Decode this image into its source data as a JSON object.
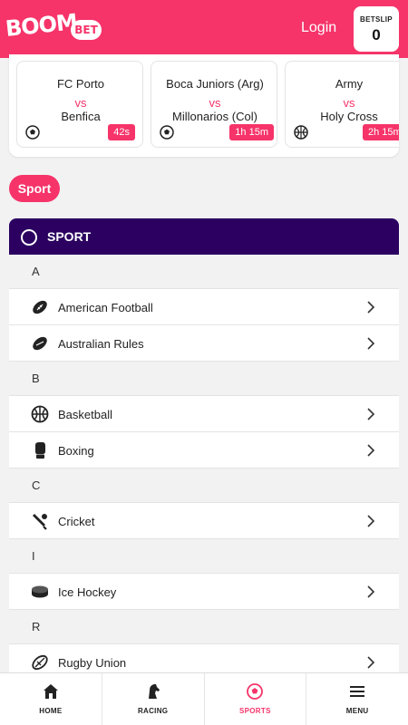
{
  "header": {
    "logo_text": "BOOM",
    "logo_badge": "BET",
    "login_label": "Login",
    "betslip_label": "BETSLIP",
    "betslip_count": "0"
  },
  "live_matches": [
    {
      "home": "FC Porto",
      "vs": "vs",
      "away": "Benfica",
      "time": "42s",
      "sport_icon": "soccer-ball-icon"
    },
    {
      "home": "Boca Juniors (Arg)",
      "vs": "vs",
      "away": "Millonarios (Col)",
      "time": "1h 15m",
      "sport_icon": "soccer-ball-icon"
    },
    {
      "home": "Army",
      "vs": "vs",
      "away": "Holy Cross",
      "time": "2h 15m",
      "sport_icon": "basketball-icon"
    }
  ],
  "filter_chip": "Sport",
  "sport_panel": {
    "title": "SPORT",
    "groups": [
      {
        "letter": "A",
        "items": [
          {
            "label": "American Football",
            "icon": "american-football-icon"
          },
          {
            "label": "Australian Rules",
            "icon": "australian-rules-icon"
          }
        ]
      },
      {
        "letter": "B",
        "items": [
          {
            "label": "Basketball",
            "icon": "basketball-icon"
          },
          {
            "label": "Boxing",
            "icon": "boxing-glove-icon"
          }
        ]
      },
      {
        "letter": "C",
        "items": [
          {
            "label": "Cricket",
            "icon": "cricket-icon"
          }
        ]
      },
      {
        "letter": "I",
        "items": [
          {
            "label": "Ice Hockey",
            "icon": "hockey-puck-icon"
          }
        ]
      },
      {
        "letter": "R",
        "items": [
          {
            "label": "Rugby Union",
            "icon": "rugby-ball-icon"
          }
        ]
      }
    ]
  },
  "bottom_nav": [
    {
      "label": "HOME",
      "icon": "home-icon",
      "active": false
    },
    {
      "label": "RACING",
      "icon": "racing-icon",
      "active": false
    },
    {
      "label": "SPORTS",
      "icon": "soccer-ball-icon",
      "active": true
    },
    {
      "label": "MENU",
      "icon": "hamburger-menu-icon",
      "active": false
    }
  ],
  "colors": {
    "brand_pink": "#f6346a",
    "panel_purple": "#2b0060",
    "background": "#f2f2f2"
  }
}
